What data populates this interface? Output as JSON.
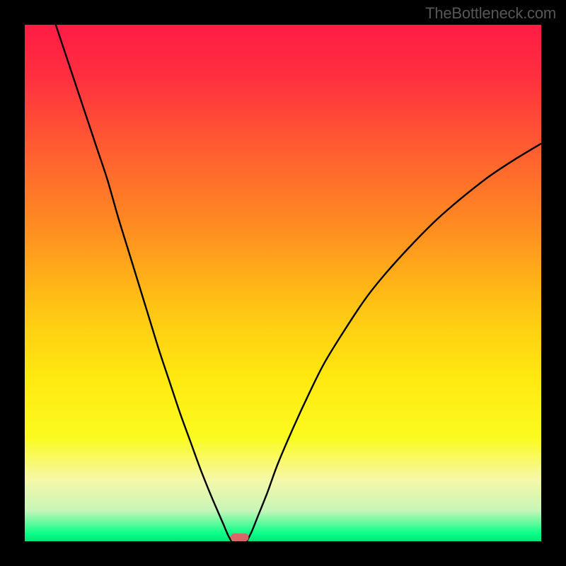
{
  "attribution": "TheBottleneck.com",
  "chart_data": {
    "type": "line",
    "title": "",
    "xlabel": "",
    "ylabel": "",
    "xlim": [
      0,
      100
    ],
    "ylim": [
      0,
      100
    ],
    "background_gradient": {
      "stops": [
        {
          "offset": 0.0,
          "color": "#ff1c44"
        },
        {
          "offset": 0.1,
          "color": "#ff2f40"
        },
        {
          "offset": 0.25,
          "color": "#ff6030"
        },
        {
          "offset": 0.4,
          "color": "#ff8f20"
        },
        {
          "offset": 0.55,
          "color": "#ffc514"
        },
        {
          "offset": 0.68,
          "color": "#ffe810"
        },
        {
          "offset": 0.8,
          "color": "#fbfb20"
        },
        {
          "offset": 0.88,
          "color": "#f6f8a8"
        },
        {
          "offset": 0.94,
          "color": "#c8f5b8"
        },
        {
          "offset": 0.985,
          "color": "#0aff88"
        },
        {
          "offset": 1.0,
          "color": "#00e574"
        }
      ]
    },
    "series": [
      {
        "name": "left-curve",
        "x": [
          6,
          8,
          10,
          12,
          14,
          16,
          18,
          20,
          22,
          24,
          26,
          28,
          30,
          32,
          34,
          36,
          37.5,
          38.5,
          39.3,
          40
        ],
        "y": [
          100,
          94,
          88,
          82,
          76,
          70,
          63,
          56.5,
          50,
          43.5,
          37,
          31,
          25,
          19.5,
          14,
          9,
          5.5,
          3.2,
          1.3,
          0
        ]
      },
      {
        "name": "right-curve",
        "x": [
          43,
          44,
          45,
          47,
          49,
          52,
          55,
          58,
          62,
          66,
          70,
          75,
          80,
          85,
          90,
          95,
          100
        ],
        "y": [
          0,
          2,
          4.5,
          9.5,
          15,
          22,
          28.5,
          34.5,
          41,
          47,
          52,
          57.5,
          62.5,
          66.8,
          70.7,
          74,
          77
        ]
      }
    ],
    "marker": {
      "name": "optimal-marker",
      "x": 41.6,
      "width": 3.5,
      "color": "#d96767"
    }
  }
}
